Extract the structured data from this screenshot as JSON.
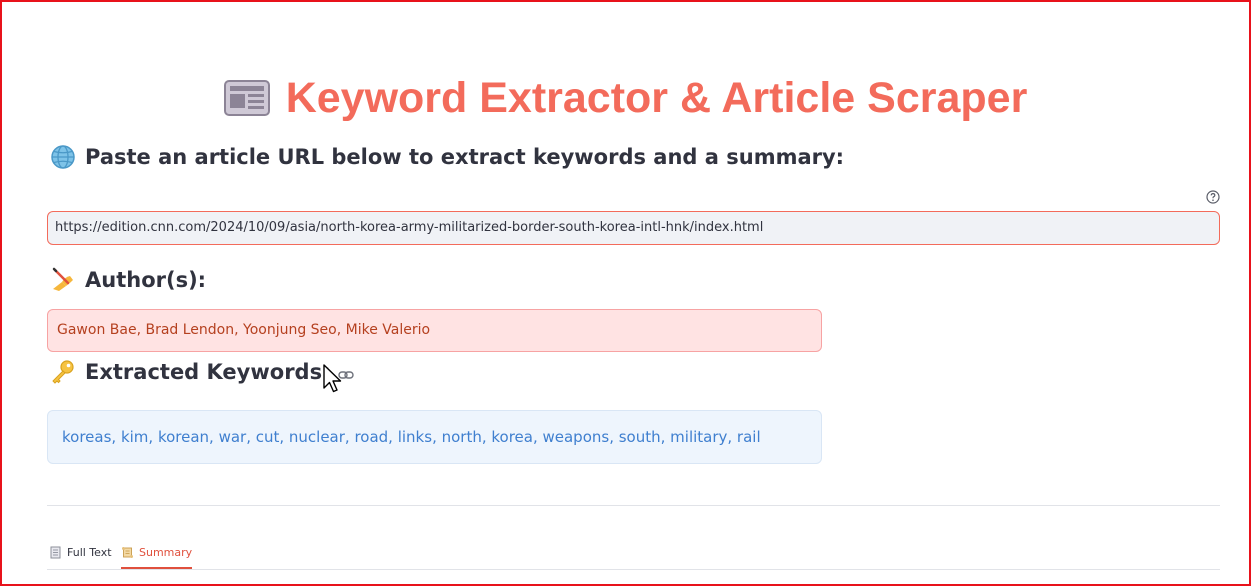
{
  "page": {
    "title": "Keyword Extractor & Article Scraper",
    "title_icon": "newspaper-icon",
    "accent_color": "#f36b5b"
  },
  "url_section": {
    "heading": "Paste an article URL below to extract keywords and a summary:",
    "heading_icon": "globe-icon",
    "help_icon": "help-circle-icon",
    "url_value": "https://edition.cnn.com/2024/10/09/asia/north-korea-army-militarized-border-south-korea-intl-hnk/index.html"
  },
  "authors_section": {
    "heading": "Author(s):",
    "heading_icon": "writing-hand-icon",
    "authors": "Gawon Bae, Brad Lendon, Yoonjung Seo, Mike Valerio"
  },
  "keywords_section": {
    "heading": "Extracted Keywords:",
    "heading_icon": "key-icon",
    "anchor_icon": "link-icon",
    "keywords": "koreas, kim, korean, war, cut, nuclear, road, links, north, korea, weapons, south, military, rail"
  },
  "tabs": [
    {
      "label": "Full Text",
      "icon": "page-icon",
      "active": false
    },
    {
      "label": "Summary",
      "icon": "scroll-icon",
      "active": true
    }
  ]
}
